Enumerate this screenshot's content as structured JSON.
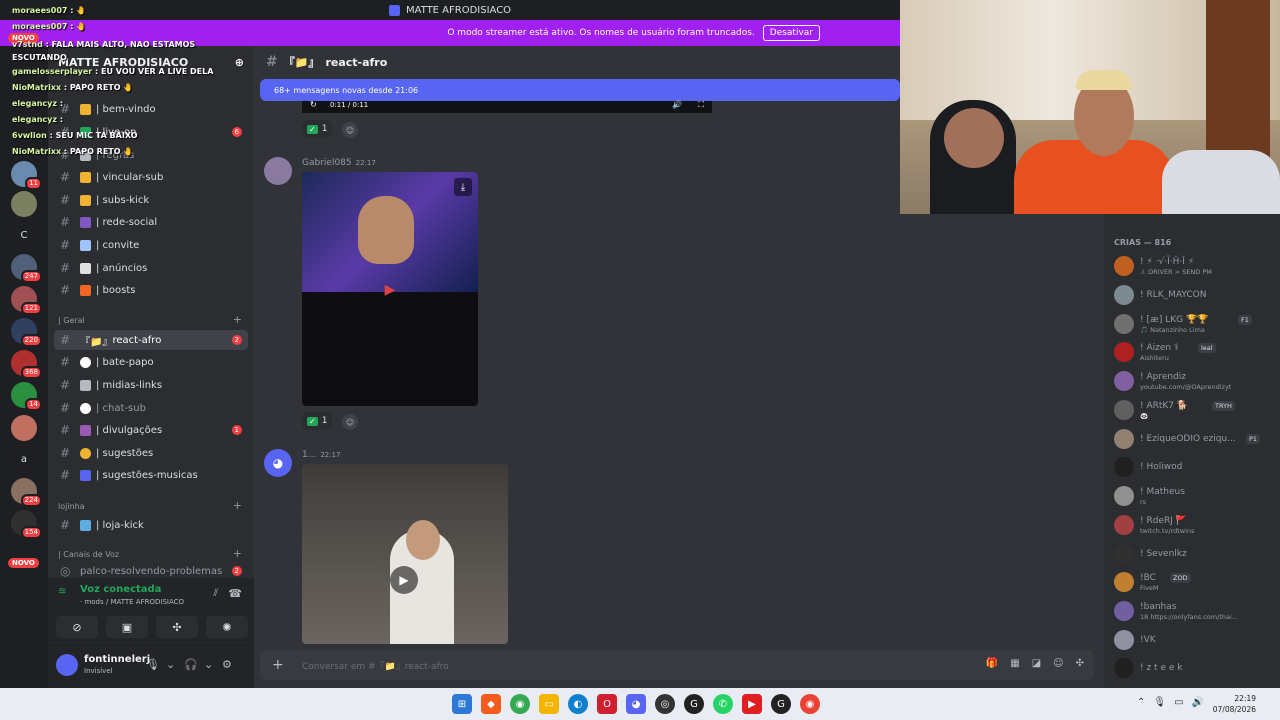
{
  "window": {
    "title": "MATTE AFRODISIACO"
  },
  "banner": {
    "text": "O modo streamer está ativo. Os nomes de usuário foram truncados.",
    "button": "Desativar"
  },
  "guild": {
    "name": "MATTE AFRODISIACO"
  },
  "channels": [
    {
      "label": "| bem-vindo",
      "emoji_color": "#f0b232"
    },
    {
      "label": "| live-on",
      "emoji_color": "#23a55a",
      "count": "6"
    },
    {
      "label": "| regras",
      "emoji_color": "#b5bac1"
    },
    {
      "label": "| vincular-sub",
      "emoji_color": "#f0b232"
    },
    {
      "label": "| subs-kick",
      "emoji_color": "#f0b232"
    },
    {
      "label": "| rede-social",
      "emoji_color": "#7e57c2"
    },
    {
      "label": "| convite",
      "emoji_color": "#a0c4ff"
    },
    {
      "label": "| anúncios",
      "emoji_color": "#e0e0e0"
    },
    {
      "label": "| boosts",
      "emoji_color": "#f26522"
    }
  ],
  "category_geral": "| Geral",
  "channels_geral": [
    {
      "label": "react-afro",
      "prefix": "『📁』",
      "emoji_color": "#f0b232",
      "count": "2"
    },
    {
      "label": "| bate-papo",
      "emoji_color": "#ffffff"
    },
    {
      "label": "| midias-links",
      "emoji_color": "#b5bac1"
    },
    {
      "label": "| chat-sub",
      "emoji_color": "#ffffff"
    },
    {
      "label": "| divulgações",
      "emoji_color": "#9b59b6",
      "count": "1"
    },
    {
      "label": "| sugestões",
      "emoji_color": "#f0b232"
    },
    {
      "label": "| sugestões-musicas",
      "emoji_color": "#5865f2"
    }
  ],
  "category_lojinha": "lojinha",
  "channels_lojinha": [
    {
      "label": "| loja-kick",
      "emoji_color": "#5dade2"
    }
  ],
  "category_voz": "| Canais de Voz",
  "voice_channel": {
    "label": "palco-resolvendo-problemas",
    "count": "2"
  },
  "voice": {
    "status": "Voz conectada",
    "location": "· mods / MATTE AFRODISIACO"
  },
  "user": {
    "name": "fontinnelerj",
    "status": "Invisível"
  },
  "chat": {
    "channel_name": "react-afro",
    "channel_prefix": "『📁』",
    "new_messages": "68+ mensagens novas desde 21:06",
    "video_time": "0:11 / 0:11",
    "messages": [
      {
        "author": "Gabriel085",
        "time": "22:17",
        "reaction_count": "1"
      },
      {
        "author": "1...",
        "time": "22:17"
      }
    ],
    "first_reaction_count": "1",
    "placeholder": "Conversar em #『📁』react-afro"
  },
  "members": {
    "section": "CRIAS — 816",
    "list": [
      {
        "name": "! ⚡ ·√·Ĩ·Ĥ·Ĭ ⚡",
        "sub": ".I. DRIVER > SEND PM",
        "color": "#c06020"
      },
      {
        "name": "! RLK_MAYCON",
        "sub": "",
        "color": "#7a8a90"
      },
      {
        "name": "! [æ] LKG 🏆🏆",
        "sub": "🎵 Natanzinho Lima",
        "color": "#707070",
        "tag": "F1"
      },
      {
        "name": "! Aizen ⚕",
        "sub": "Aishiteru",
        "color": "#b02020",
        "tag": "leal"
      },
      {
        "name": "! Aprendiz",
        "sub": "youtube.com/@OAprendizyt",
        "color": "#8060a0"
      },
      {
        "name": "! ARtK7 🐕",
        "sub": "🐼",
        "color": "#606060",
        "tag": "TRYH"
      },
      {
        "name": "! EziqueODIO eziqu...",
        "sub": "",
        "color": "#908070",
        "tag": "P1"
      },
      {
        "name": "! Holiwod",
        "sub": "",
        "color": "#202020"
      },
      {
        "name": "! Matheus",
        "sub": "rs",
        "color": "#909090"
      },
      {
        "name": "! RdeRJ 🚩",
        "sub": "twitch.tv/rdtwins",
        "color": "#a04040"
      },
      {
        "name": "! Sevenlkz",
        "sub": "",
        "color": "#303030"
      },
      {
        "name": "!BC",
        "sub": "FiveM",
        "color": "#c08030",
        "tag": "ZOD"
      },
      {
        "name": "!banhas",
        "sub": "18 https://onlyfans.com/thai...",
        "color": "#7060a0"
      },
      {
        "name": "!VK",
        "sub": "",
        "color": "#9090a0"
      },
      {
        "name": "! z t e e k",
        "sub": "",
        "color": "#202020"
      }
    ]
  },
  "overlay_chat": [
    {
      "name": "moraees007",
      "text": ": 🤚"
    },
    {
      "name": "moraees007",
      "text": ": 🤚"
    },
    {
      "name": "v7stnd",
      "text": ": FALA MAIS ALTO, NAO ESTAMOS ESCUTANDO"
    },
    {
      "name": "gamelosserplayer",
      "text": ": EU VOU VER A LIVE DELA"
    },
    {
      "name": "NioMatrixx",
      "text": ": PAPO RETO 🤚"
    },
    {
      "name": "elegancyz",
      "text": ":"
    },
    {
      "name": "elegancyz",
      "text": ":"
    },
    {
      "name": "6vwlion",
      "text": ": SEU MIC TA BAIXO"
    },
    {
      "name": "NioMatrixx",
      "text": ": PAPO RETO 🤚"
    }
  ],
  "server_badges": [
    "NOVO",
    "11",
    "247",
    "121",
    "220",
    "368",
    "14",
    "224",
    "154",
    "NOVO"
  ],
  "server_letters": [
    "C",
    "a"
  ],
  "taskbar": {
    "time": "22:19",
    "date": "07/08/2026"
  }
}
